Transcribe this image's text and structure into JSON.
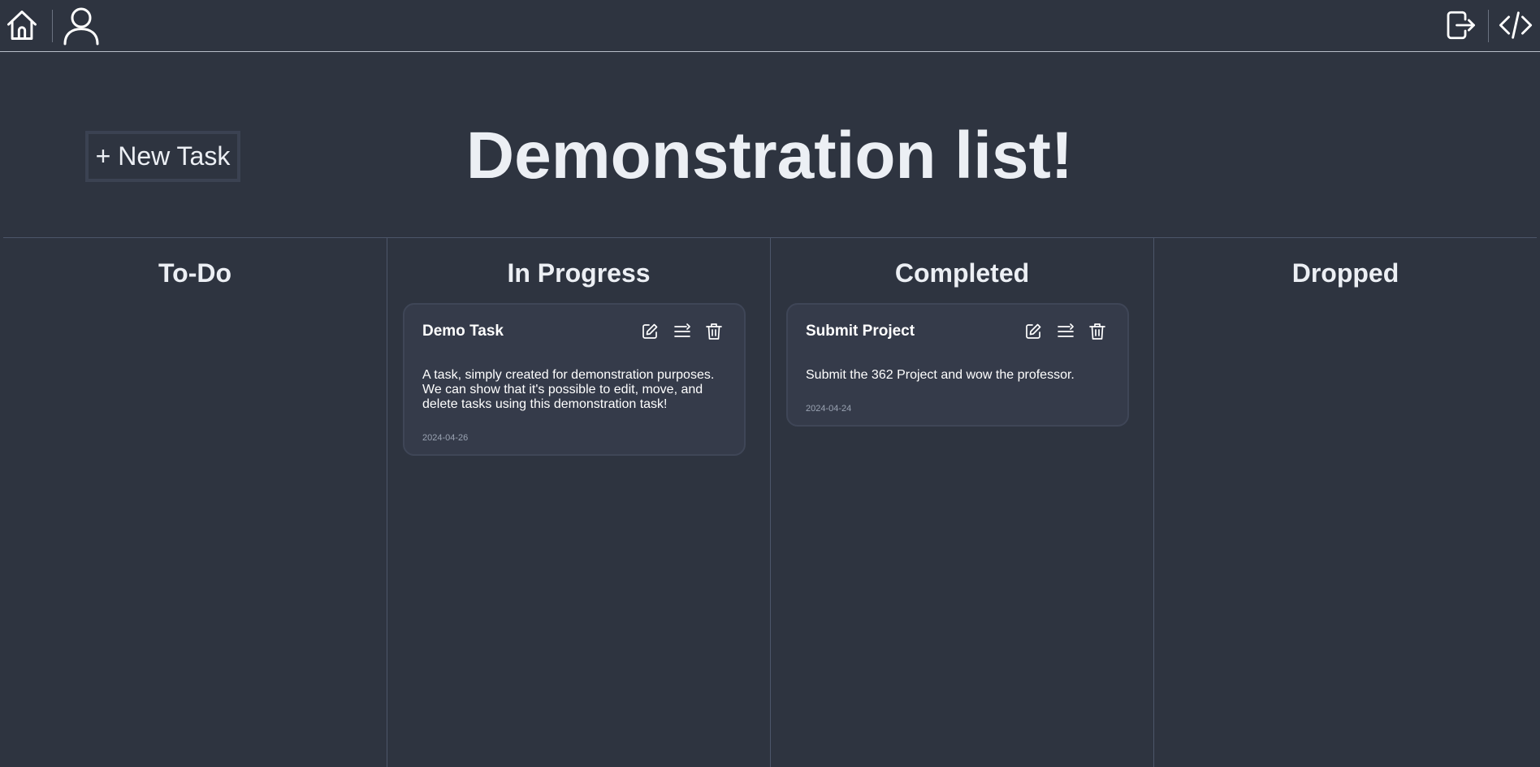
{
  "header": {
    "icons": {
      "home": "home-icon",
      "profile": "user-icon",
      "logout": "logout-icon",
      "code": "code-icon"
    }
  },
  "toolbar": {
    "new_task_label": "+ New Task"
  },
  "page": {
    "title": "Demonstration list!"
  },
  "columns": [
    {
      "title": "To-Do"
    },
    {
      "title": "In Progress"
    },
    {
      "title": "Completed"
    },
    {
      "title": "Dropped"
    }
  ],
  "cards": [
    {
      "column": "In Progress",
      "title": "Demo Task",
      "description": "A task, simply created for demonstration purposes. We can show that it's possible to edit, move, and delete tasks using this demonstration task!",
      "date": "2024-04-26"
    },
    {
      "column": "Completed",
      "title": "Submit Project",
      "description": "Submit the 362 Project and wow the professor.",
      "date": "2024-04-24"
    }
  ],
  "colors": {
    "background": "#2e3440",
    "card_background": "#353b4a",
    "text": "#eceff4",
    "muted": "#9aa3b2"
  }
}
